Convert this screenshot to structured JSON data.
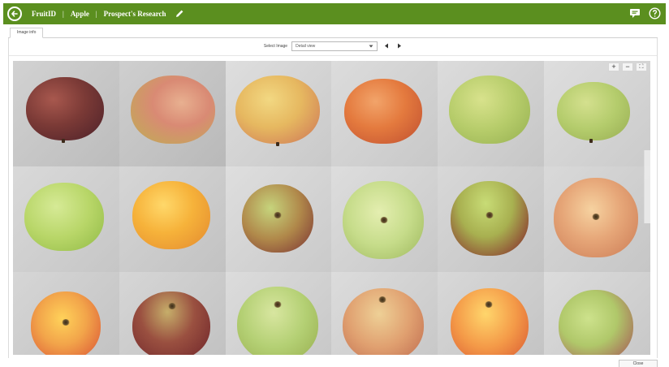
{
  "header": {
    "crumbs": [
      "FruitID",
      "Apple",
      "Prospect's Research"
    ],
    "separator": "|"
  },
  "tabs": [
    {
      "label": "Image info"
    }
  ],
  "toolbar": {
    "select_label": "Select Image",
    "select_value": "Detail view"
  },
  "zoom": {
    "in_label": "+",
    "out_label": "−",
    "fullscreen_label": "⛶"
  },
  "footer": {
    "close_label": "Close"
  },
  "colors": {
    "brand": "#5b8f1f"
  },
  "icons": [
    "back-arrow-icon",
    "pencil-icon",
    "comment-icon",
    "help-icon",
    "chevron-down-icon",
    "arrow-left-icon",
    "arrow-right-icon"
  ]
}
